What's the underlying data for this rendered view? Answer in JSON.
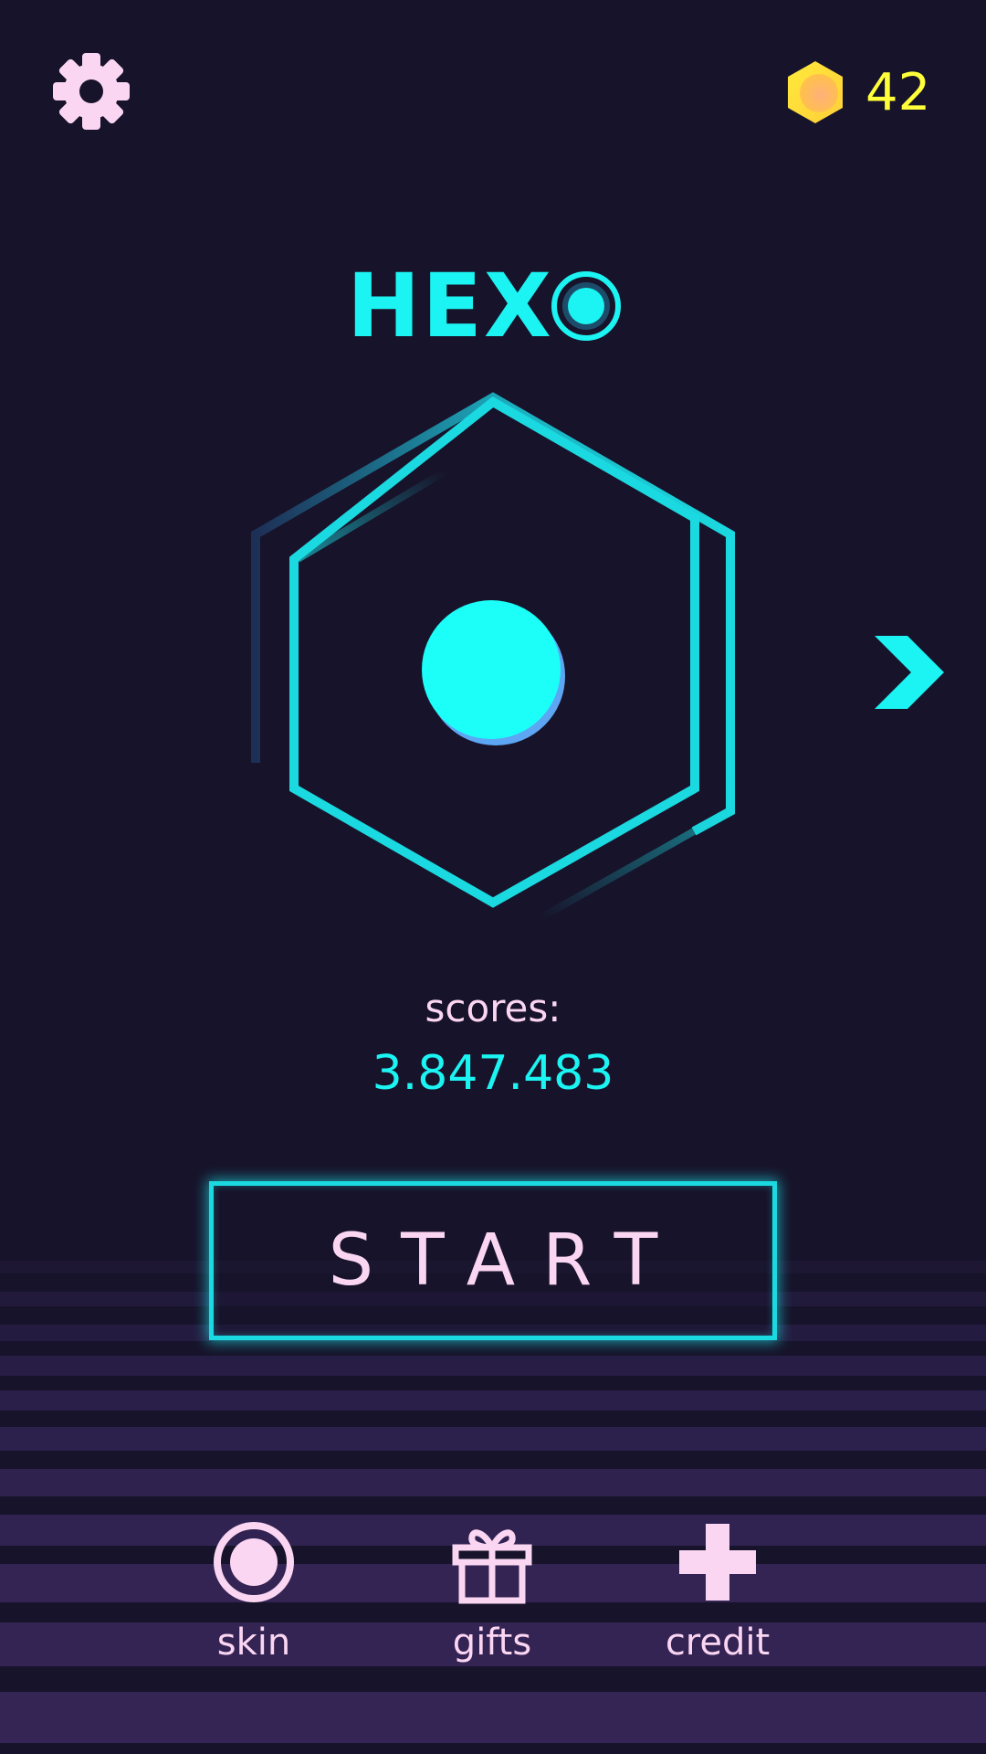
{
  "header": {
    "settings_icon": "gear-icon",
    "coin_icon": "hexagon-coin-icon",
    "coins": "42"
  },
  "logo": {
    "text": "HEX",
    "o_icon": "ring-dot-icon"
  },
  "stage": {
    "player_icon": "cyan-ball",
    "next_icon": "chevron-right-icon"
  },
  "scores": {
    "label": "scores:",
    "value": "3.847.483"
  },
  "start": {
    "label": "START"
  },
  "nav": {
    "items": [
      {
        "label": "skin",
        "icon": "skin-ring-icon"
      },
      {
        "label": "gifts",
        "icon": "gift-icon"
      },
      {
        "label": "credit",
        "icon": "plus-icon"
      }
    ]
  },
  "colors": {
    "background": "#17132a",
    "accent": "#1bf4f2",
    "text": "#fbd6f2",
    "coin_text": "#ffff3a",
    "stripe": "#33214f"
  }
}
